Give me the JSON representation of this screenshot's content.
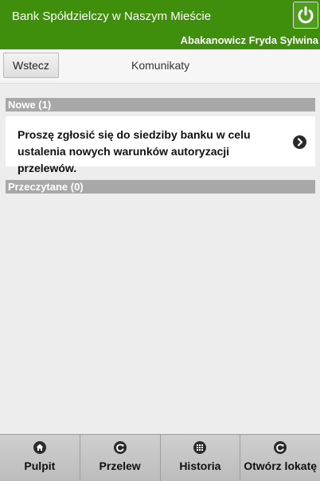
{
  "header": {
    "bank_name": "Bank Spółdzielczy w Naszym Mieście",
    "user_name": "Abakanowicz Fryda Sylwina",
    "logout_icon": "power-icon",
    "color": "#3f8f0c"
  },
  "toolbar": {
    "back_label": "Wstecz",
    "title": "Komunikaty"
  },
  "sections": {
    "new_label": "Nowe (1)",
    "read_label": "Przeczytane (0)"
  },
  "messages": [
    {
      "text": "Proszę zgłosić się do siedziby banku w celu ustalenia nowych warunków autoryzacji przelewów.",
      "icon": "chevron-right-icon"
    }
  ],
  "bottom_nav": [
    {
      "label": "Pulpit",
      "icon": "home-icon"
    },
    {
      "label": "Przelew",
      "icon": "refresh-icon"
    },
    {
      "label": "Historia",
      "icon": "grid-icon"
    },
    {
      "label": "Otwórz lokatę",
      "icon": "refresh-icon"
    }
  ]
}
